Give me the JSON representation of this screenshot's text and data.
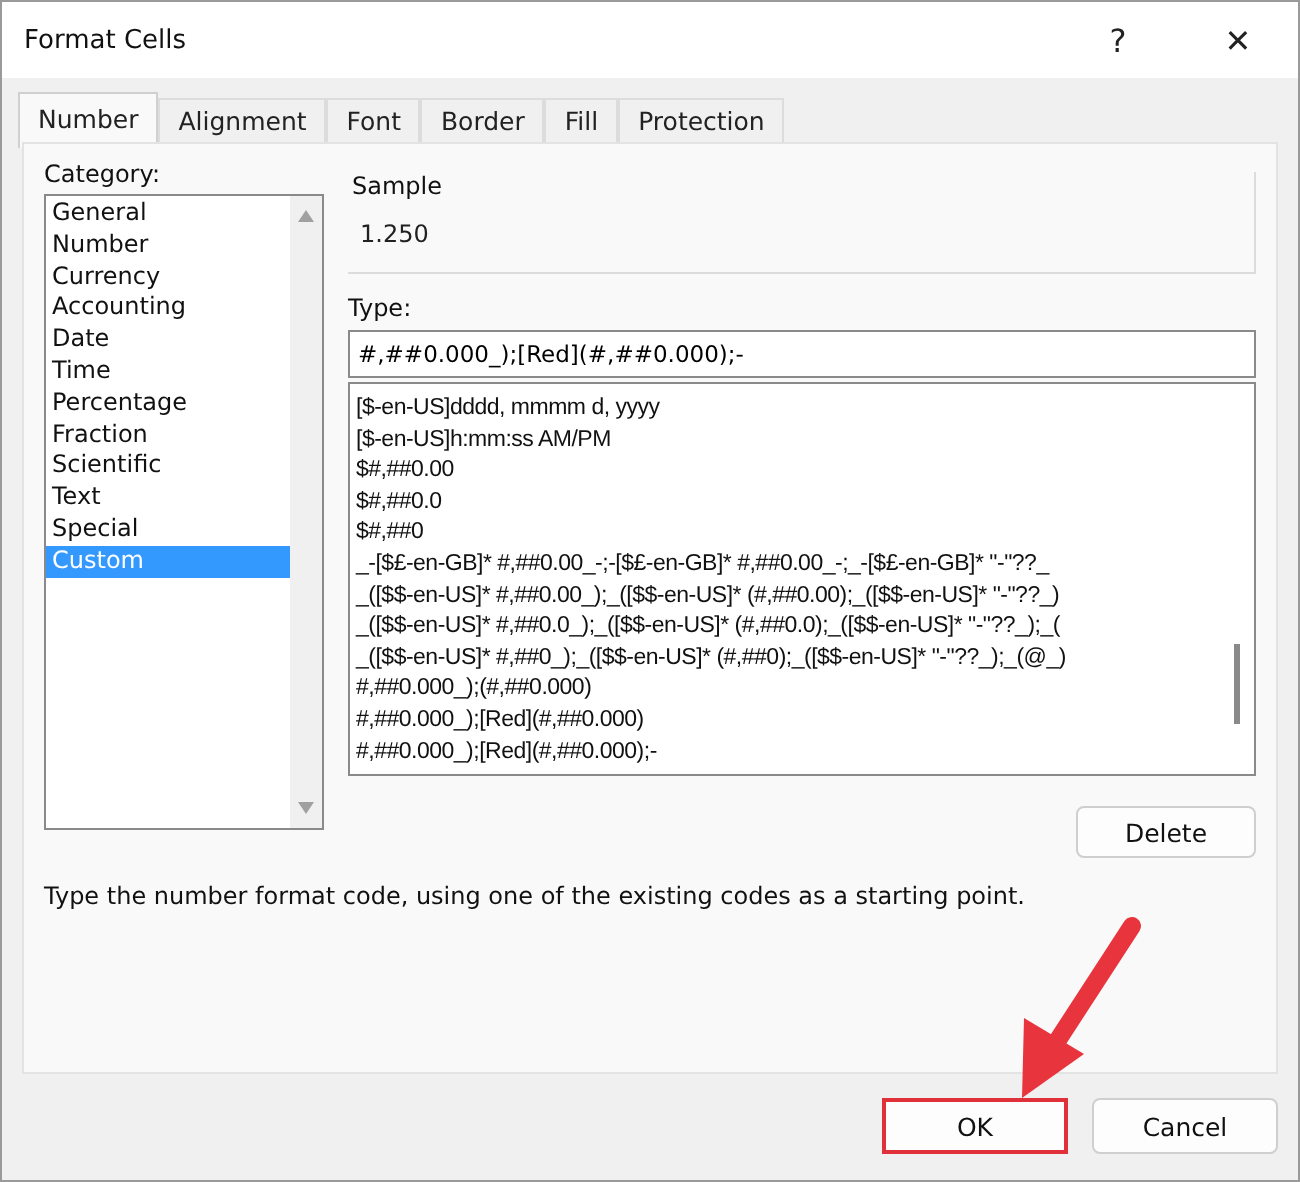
{
  "window": {
    "title": "Format Cells",
    "help": "?",
    "close": "✕"
  },
  "tabs": [
    {
      "label": "Number",
      "selected": true
    },
    {
      "label": "Alignment",
      "selected": false
    },
    {
      "label": "Font",
      "selected": false
    },
    {
      "label": "Border",
      "selected": false
    },
    {
      "label": "Fill",
      "selected": false
    },
    {
      "label": "Protection",
      "selected": false
    }
  ],
  "category": {
    "label": "Category:",
    "items": [
      {
        "label": "General",
        "selected": false
      },
      {
        "label": "Number",
        "selected": false
      },
      {
        "label": "Currency",
        "selected": false
      },
      {
        "label": "Accounting",
        "selected": false
      },
      {
        "label": "Date",
        "selected": false
      },
      {
        "label": "Time",
        "selected": false
      },
      {
        "label": "Percentage",
        "selected": false
      },
      {
        "label": "Fraction",
        "selected": false
      },
      {
        "label": "Scientific",
        "selected": false
      },
      {
        "label": "Text",
        "selected": false
      },
      {
        "label": "Special",
        "selected": false
      },
      {
        "label": "Custom",
        "selected": true
      }
    ]
  },
  "sample": {
    "label": "Sample",
    "value": "1.250"
  },
  "type": {
    "label": "Type:",
    "value": "#,##0.000_);[Red](#,##0.000);-",
    "formats": [
      "[$-en-US]dddd, mmmm d, yyyy",
      "[$-en-US]h:mm:ss AM/PM",
      "$#,##0.00",
      "$#,##0.0",
      "$#,##0",
      "_-[$£-en-GB]* #,##0.00_-;-[$£-en-GB]* #,##0.00_-;_-[$£-en-GB]* \"-\"??_",
      "_([$$-en-US]* #,##0.00_);_([$$-en-US]* (#,##0.00);_([$$-en-US]* \"-\"??_)",
      "_([$$-en-US]* #,##0.0_);_([$$-en-US]* (#,##0.0);_([$$-en-US]* \"-\"??_);_(",
      "_([$$-en-US]* #,##0_);_([$$-en-US]* (#,##0);_([$$-en-US]* \"-\"??_);_(@_)",
      "#,##0.000_);(#,##0.000)",
      "#,##0.000_);[Red](#,##0.000)",
      "#,##0.000_);[Red](#,##0.000);-"
    ]
  },
  "delete_button": "Delete",
  "hint": "Type the number format code, using one of the existing codes as a starting point.",
  "buttons": [
    {
      "label": "OK",
      "highlighted": true
    },
    {
      "label": "Cancel",
      "highlighted": false
    }
  ]
}
